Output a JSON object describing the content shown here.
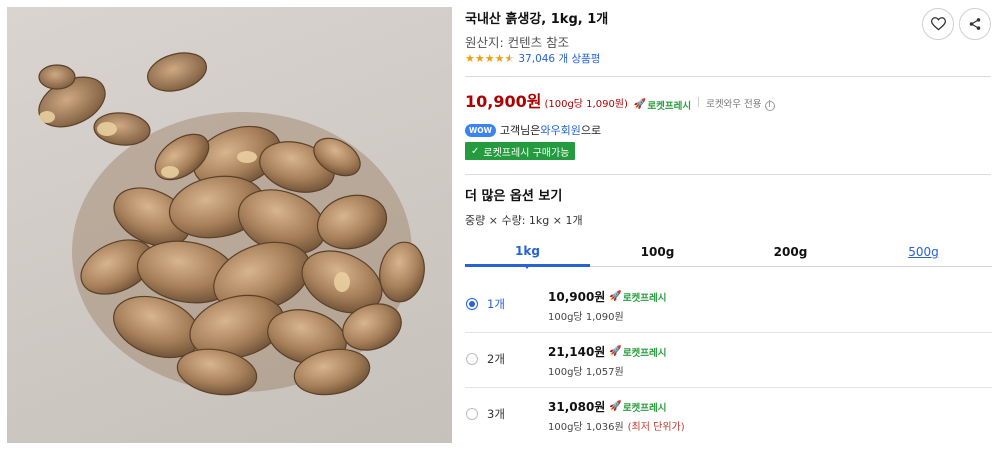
{
  "product": {
    "title": "국내산 흙생강, 1kg, 1개",
    "origin": "원산지: 컨텐츠 참조",
    "rating": 4.5,
    "review_count_text": "37,046 개 상품평"
  },
  "icons": {
    "wishlist": "heart-icon",
    "share": "share-icon",
    "rocket": "rocket-icon"
  },
  "price": {
    "main": "10,900원",
    "unit": "(100g당 1,090원)",
    "rocket_label": "로켓프레시",
    "wow_only": "로켓와우 전용",
    "info_glyph": "i"
  },
  "wow": {
    "tag": "WOW",
    "text_before": "고객님은 ",
    "link": "와우회원",
    "text_after": "으로",
    "fresh_button": "로켓프레시 구매가능"
  },
  "options": {
    "title": "더 많은 옵션 보기",
    "spec": "중량 × 수량: 1kg × 1개",
    "tabs": [
      {
        "label": "1kg",
        "state": "active"
      },
      {
        "label": "100g",
        "state": "normal"
      },
      {
        "label": "200g",
        "state": "normal"
      },
      {
        "label": "500g",
        "state": "link"
      }
    ],
    "rows": [
      {
        "qty": "1개",
        "price": "10,900원",
        "rocket": "로켓프레시",
        "unit": "100g당 1,090원",
        "note": "",
        "selected": true
      },
      {
        "qty": "2개",
        "price": "21,140원",
        "rocket": "로켓프레시",
        "unit": "100g당 1,057원",
        "note": "",
        "selected": false
      },
      {
        "qty": "3개",
        "price": "31,080원",
        "rocket": "로켓프레시",
        "unit": "100g당 1,036원",
        "note": "(최저 단위가)",
        "selected": false
      }
    ]
  },
  "colors": {
    "price_red": "#ae0000",
    "accent_blue": "#2563d6",
    "rocket_green": "#2a9d3e",
    "fresh_button_green": "#249b3e"
  }
}
